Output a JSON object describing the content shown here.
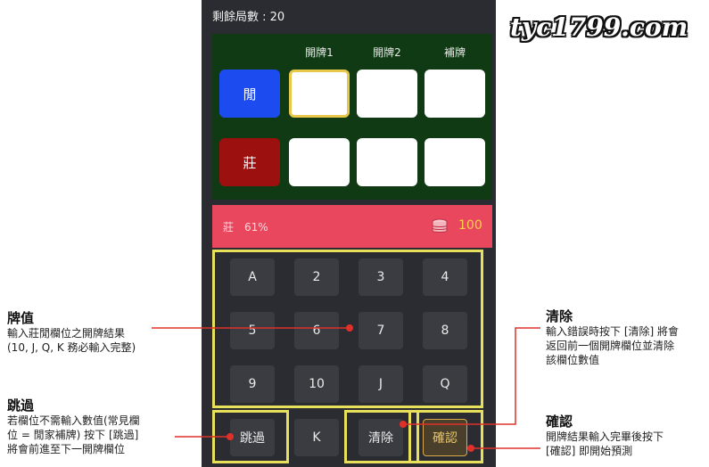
{
  "header": {
    "remaining_label": "剩餘局數 : 20"
  },
  "board": {
    "columns": [
      "開牌1",
      "開牌2",
      "補牌"
    ],
    "player_label": "閒",
    "banker_label": "莊"
  },
  "result": {
    "label": "莊　61%",
    "amount": "100"
  },
  "keypad": {
    "keys": [
      "A",
      "2",
      "3",
      "4",
      "5",
      "6",
      "7",
      "8",
      "9",
      "10",
      "J",
      "Q"
    ],
    "skip": "跳過",
    "k": "K",
    "clear": "清除",
    "confirm": "確認"
  },
  "callouts": {
    "card_value": {
      "title": "牌值",
      "desc": "輸入莊閒欄位之開牌結果\n(10, J, Q, K 務必輸入完整)"
    },
    "skip": {
      "title": "跳過",
      "desc": "若欄位不需輸入數值(常見欄\n位 = 閒家補牌) 按下 [跳過]\n將會前進至下一開牌欄位"
    },
    "clear": {
      "title": "清除",
      "desc": "輸入錯誤時按下 [清除] 將會\n返回前一個開牌欄位並清除\n該欄位數值"
    },
    "confirm": {
      "title": "確認",
      "desc": "開牌結果輸入完畢後按下\n[確認] 即開始預測"
    }
  },
  "watermark": "tyc1799.com",
  "colors": {
    "accent_line": "#e0302a",
    "highlight": "#e8e05a",
    "board_bg": "#0f3a13",
    "result_bg": "#e8475e"
  }
}
